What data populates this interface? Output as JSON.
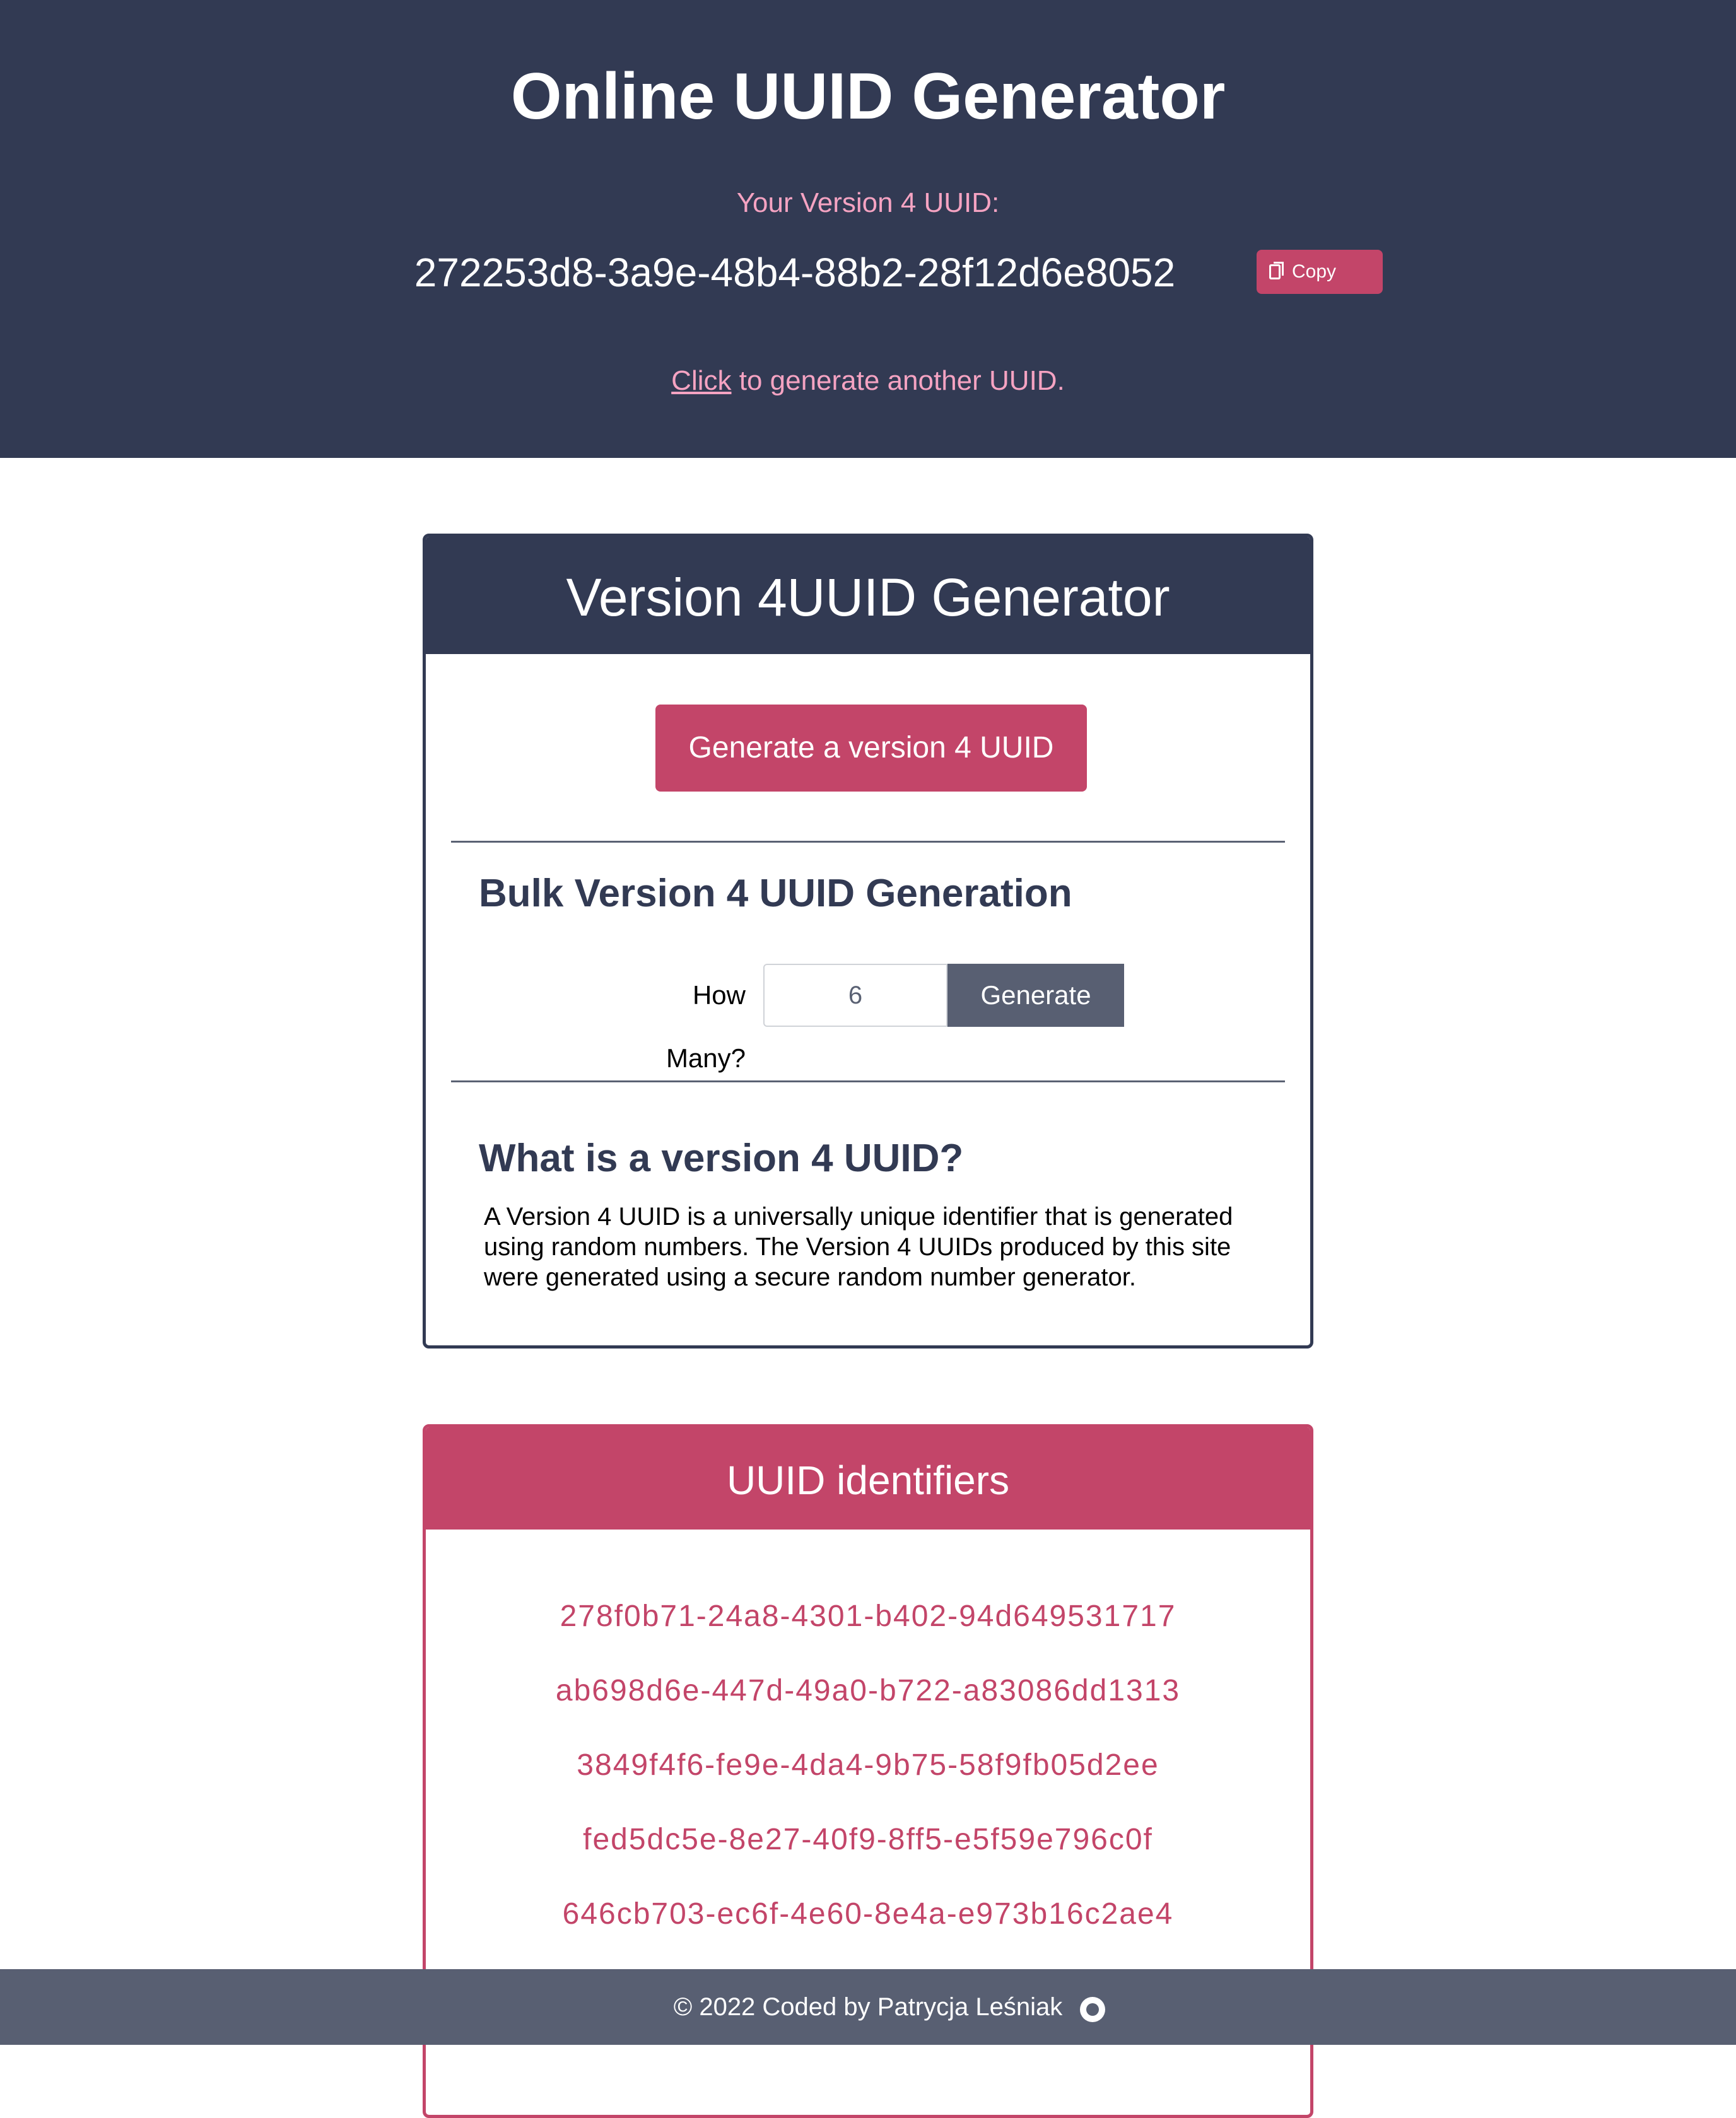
{
  "header": {
    "title": "Online UUID Generator",
    "subtitle": "Your Version 4 UUID:",
    "uuid": "272253d8-3a9e-48b4-88b2-28f12d6e8052",
    "copy_label": "Copy",
    "regen_link": "Click",
    "regen_text": " to generate another UUID."
  },
  "generator_card": {
    "title": "Version 4UUID Generator",
    "generate_label": "Generate a version 4 UUID",
    "bulk_title": "Bulk Version 4 UUID Generation",
    "how_many_label": "How Many?",
    "how_many_value": "6",
    "bulk_generate_label": "Generate",
    "about_title": "What is a version 4 UUID?",
    "about_lines": [
      "A Version 4 UUID is a universally unique identifier that is generated",
      "using random numbers. The Version 4 UUIDs produced by this site",
      "were generated using a secure random number generator."
    ]
  },
  "identifiers_card": {
    "title": "UUID identifiers",
    "items": [
      "278f0b71-24a8-4301-b402-94d649531717",
      "ab698d6e-447d-49a0-b722-a83086dd1313",
      "3849f4f6-fe9e-4da4-9b75-58f9fb05d2ee",
      "fed5dc5e-8e27-40f9-8ff5-e5f59e796c0f",
      "646cb703-ec6f-4e60-8e4a-e973b16c2ae4"
    ]
  },
  "footer": {
    "text": "© 2022 Coded by Patrycja Leśniak",
    "icon": "github-icon"
  },
  "colors": {
    "navy": "#323a53",
    "pink": "#c34569",
    "light_pink": "#f5a3c2",
    "slate": "#585f72"
  }
}
